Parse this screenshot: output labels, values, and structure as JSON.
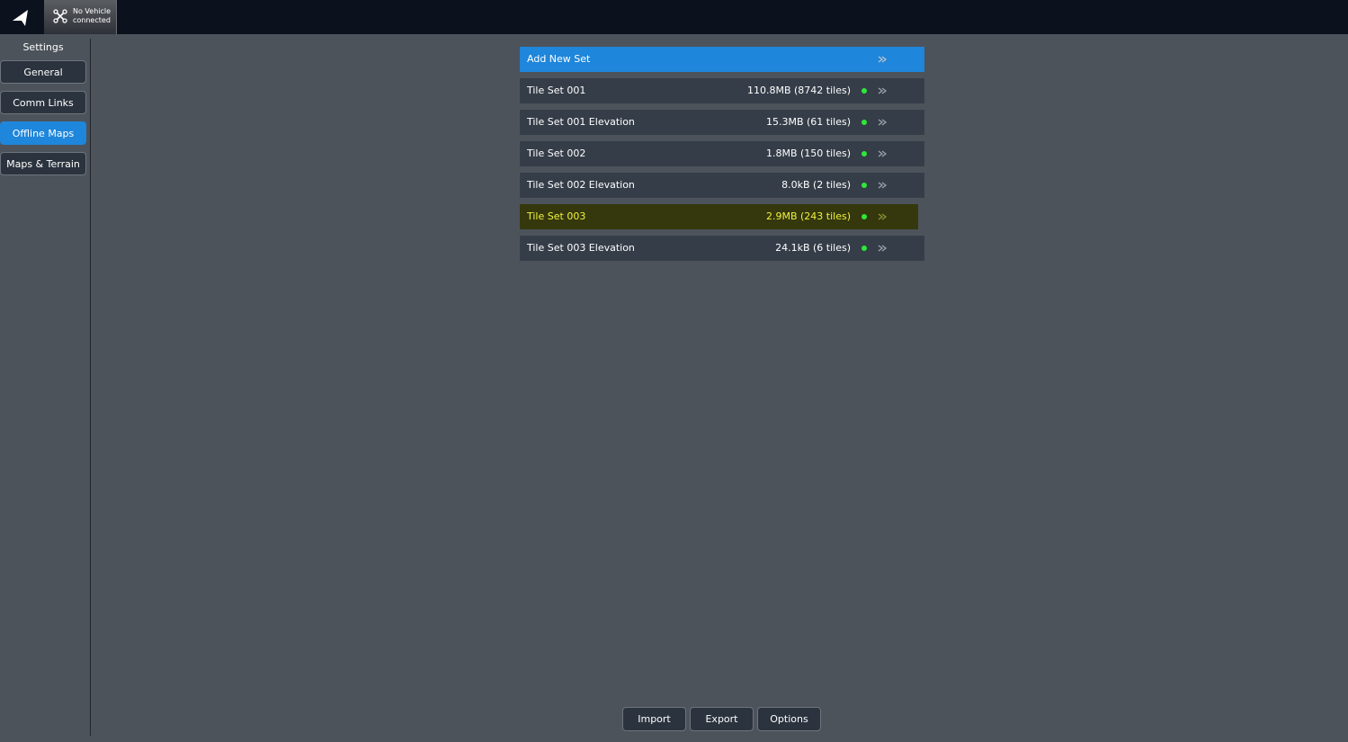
{
  "toolbar": {
    "vehicle_status_line1": "No Vehicle",
    "vehicle_status_line2": "connected"
  },
  "sidebar": {
    "title": "Settings",
    "items": [
      {
        "label": "General",
        "active": false
      },
      {
        "label": "Comm Links",
        "active": false
      },
      {
        "label": "Offline Maps",
        "active": true
      },
      {
        "label": "Maps & Terrain",
        "active": false
      }
    ]
  },
  "tile_sets": {
    "add_label": "Add New Set",
    "rows": [
      {
        "name": "Tile Set 001",
        "size": "110.8MB (8742 tiles)"
      },
      {
        "name": "Tile Set 001 Elevation",
        "size": "15.3MB (61 tiles)"
      },
      {
        "name": "Tile Set 002",
        "size": "1.8MB (150 tiles)"
      },
      {
        "name": "Tile Set 002 Elevation",
        "size": "8.0kB (2 tiles)"
      },
      {
        "name": "Tile Set 003",
        "size": "2.9MB (243 tiles)",
        "highlighted": true
      },
      {
        "name": "Tile Set 003 Elevation",
        "size": "24.1kB (6 tiles)"
      }
    ]
  },
  "actions": {
    "import_label": "Import",
    "export_label": "Export",
    "options_label": "Options"
  },
  "colors": {
    "background": "#4d535b",
    "toolbar": "#0b111d",
    "accent": "#1e86db",
    "row": "#353d48",
    "highlight_bg": "#34380c",
    "highlight_text": "#f2f23d",
    "status_dot": "#2ee83a"
  }
}
